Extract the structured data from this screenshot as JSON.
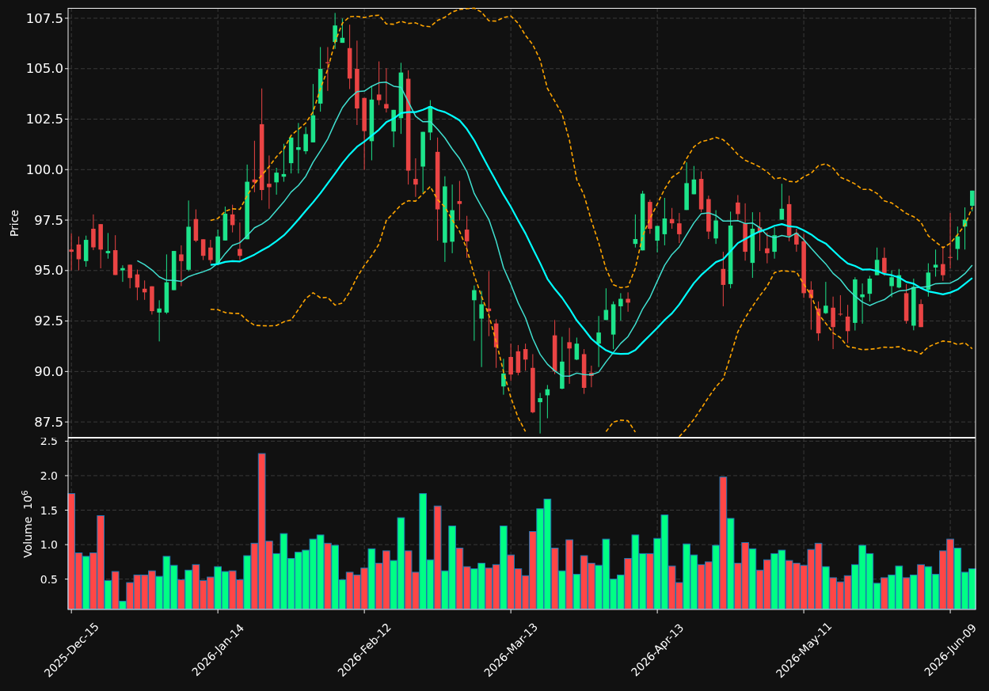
{
  "price_panel": {
    "chart_data": {
      "type": "candlestick",
      "ylabel": "Price",
      "categories": [
        null,
        null,
        null,
        null,
        null,
        null,
        null,
        null,
        null,
        null,
        null,
        null,
        null,
        null,
        null,
        null,
        null,
        null,
        null,
        null,
        null,
        null,
        null,
        null,
        null,
        null,
        null,
        null,
        null,
        null,
        null,
        null,
        null,
        null,
        null,
        null,
        null,
        null,
        null,
        null,
        null,
        null,
        null,
        null,
        null,
        null,
        null,
        null,
        null,
        null,
        null,
        null,
        null,
        null,
        null,
        null,
        null,
        null,
        null,
        null,
        null,
        null,
        null,
        null,
        null,
        null,
        null,
        null,
        null,
        null,
        null,
        null,
        null,
        null,
        null,
        null,
        null,
        null,
        null,
        null,
        null,
        null,
        null,
        null,
        null,
        null,
        null,
        null,
        null,
        null,
        null,
        null,
        null,
        null,
        null,
        null,
        null,
        null,
        null,
        null,
        null,
        null,
        null,
        null,
        null,
        null,
        null,
        null,
        null,
        null,
        null,
        null,
        null,
        null,
        null,
        null,
        null,
        null,
        null,
        null,
        null,
        null,
        null,
        null
      ],
      "ylim": [
        86.72,
        108.01
      ],
      "yticks": [
        {
          "value": 87.5,
          "label": "87.5"
        },
        {
          "value": 90,
          "label": "90.0"
        },
        {
          "value": 92.5,
          "label": "92.5"
        },
        {
          "value": 95,
          "label": "95.0"
        },
        {
          "value": 97.5,
          "label": "97.5"
        },
        {
          "value": 100,
          "label": "100.0"
        },
        {
          "value": 102.5,
          "label": "102.5"
        },
        {
          "value": 105,
          "label": "105.0"
        },
        {
          "value": 107.5,
          "label": "107.5"
        }
      ],
      "grid": true,
      "ohlc": [
        [
          96.04,
          96.84,
          95.01,
          95.93
        ],
        [
          96.29,
          96.69,
          95.01,
          95.56
        ],
        [
          95.47,
          96.73,
          95.19,
          96.52
        ],
        [
          97.07,
          97.78,
          96.01,
          96.15
        ],
        [
          97.3,
          97.3,
          95.11,
          96.04
        ],
        [
          95.86,
          96.86,
          95.59,
          95.97
        ],
        [
          96.01,
          96.75,
          94.78,
          94.78
        ],
        [
          95.01,
          95.26,
          94.44,
          95.12
        ],
        [
          95.29,
          95.29,
          94.12,
          94.63
        ],
        [
          94.81,
          95.05,
          93.53,
          94.16
        ],
        [
          94.1,
          94.51,
          93.55,
          93.92
        ],
        [
          94.22,
          94.22,
          92.82,
          92.99
        ],
        [
          92.92,
          93.53,
          91.49,
          93.12
        ],
        [
          92.92,
          95.8,
          92.85,
          94.42
        ],
        [
          94.03,
          95.97,
          94.03,
          95.97
        ],
        [
          95.8,
          96.25,
          94.23,
          95.47
        ],
        [
          95.04,
          98.47,
          94.97,
          97.17
        ],
        [
          97.55,
          98.03,
          96.41,
          96.48
        ],
        [
          96.55,
          96.55,
          95.52,
          95.73
        ],
        [
          96.14,
          96.52,
          95.36,
          95.52
        ],
        [
          95.33,
          97.03,
          95.26,
          96.69
        ],
        [
          96.49,
          98.17,
          96.49,
          97.82
        ],
        [
          97.78,
          98.26,
          96.89,
          97.25
        ],
        [
          96.07,
          97.38,
          95.52,
          95.73
        ],
        [
          96.55,
          100.25,
          96.55,
          99.4
        ],
        [
          99.51,
          101.43,
          98.88,
          99.37
        ],
        [
          102.25,
          104.02,
          98.48,
          98.99
        ],
        [
          99.3,
          100.7,
          98.06,
          99.13
        ],
        [
          99.37,
          100.09,
          98.76,
          99.85
        ],
        [
          99.65,
          101.28,
          99.4,
          99.78
        ],
        [
          100.32,
          101.59,
          99.81,
          101.59
        ],
        [
          100.98,
          102.31,
          99.81,
          101.11
        ],
        [
          100.91,
          102.11,
          100.77,
          101.76
        ],
        [
          101.35,
          104.24,
          101.35,
          102.69
        ],
        [
          103.27,
          106.07,
          102.87,
          104.99
        ],
        [
          105.32,
          106.07,
          103.9,
          105.27
        ],
        [
          106.32,
          107.76,
          105.98,
          107.14
        ],
        [
          106.28,
          107.49,
          106.28,
          106.53
        ],
        [
          106.02,
          107.18,
          103.99,
          104.51
        ],
        [
          104.99,
          106.39,
          102.21,
          103.03
        ],
        [
          103.55,
          103.55,
          99.99,
          101.91
        ],
        [
          101.41,
          104.13,
          100.46,
          103.47
        ],
        [
          103.72,
          105.36,
          103.2,
          103.44
        ],
        [
          103.25,
          105.02,
          102.83,
          103.03
        ],
        [
          101.89,
          102.96,
          101.11,
          102.96
        ],
        [
          102.55,
          105.29,
          101.77,
          104.81
        ],
        [
          104.5,
          104.92,
          99.26,
          99.95
        ],
        [
          99.54,
          100.56,
          98.65,
          99.26
        ],
        [
          100.15,
          101.87,
          98.85,
          101.87
        ],
        [
          101.84,
          103.44,
          101.46,
          103.14
        ],
        [
          100.88,
          101.59,
          96.48,
          98.03
        ],
        [
          96.38,
          99.67,
          95.43,
          99.17
        ],
        [
          96.43,
          99.26,
          95.86,
          97.99
        ],
        [
          98.44,
          99.44,
          97.48,
          98.3
        ],
        [
          97.03,
          97.71,
          95.63,
          96.45
        ],
        [
          93.53,
          94.26,
          91.52,
          94.03
        ],
        [
          92.62,
          93.99,
          90.22,
          93.33
        ],
        [
          93.12,
          94.97,
          91.75,
          92.99
        ],
        [
          92.38,
          92.59,
          90.18,
          91.2
        ],
        [
          89.26,
          90.63,
          88.85,
          89.9
        ],
        [
          90.72,
          91.38,
          89.53,
          89.85
        ],
        [
          91.0,
          91.31,
          89.81,
          89.94
        ],
        [
          91.11,
          91.38,
          90.04,
          90.59
        ],
        [
          90.18,
          90.86,
          87.93,
          87.98
        ],
        [
          88.48,
          88.94,
          86.93,
          88.68
        ],
        [
          88.82,
          89.33,
          87.68,
          89.12
        ],
        [
          91.79,
          92.55,
          89.87,
          90.01
        ],
        [
          89.15,
          91.72,
          89.12,
          90.49
        ],
        [
          91.45,
          92.16,
          89.39,
          91.14
        ],
        [
          90.59,
          91.68,
          90.56,
          91.38
        ],
        [
          90.86,
          91.11,
          88.89,
          89.19
        ],
        [
          89.94,
          90.29,
          89.22,
          89.78
        ],
        [
          91.38,
          92.75,
          90.22,
          91.93
        ],
        [
          92.55,
          94.12,
          92.55,
          93.05
        ],
        [
          91.83,
          93.47,
          91.11,
          93.33
        ],
        [
          93.23,
          93.88,
          92.52,
          93.6
        ],
        [
          93.6,
          93.92,
          92.96,
          93.41
        ],
        [
          96.32,
          97.78,
          96.14,
          96.56
        ],
        [
          96.0,
          98.95,
          96.0,
          98.81
        ],
        [
          98.4,
          98.51,
          96.82,
          97.07
        ],
        [
          96.48,
          97.21,
          95.9,
          97.21
        ],
        [
          96.8,
          98.6,
          96.25,
          97.58
        ],
        [
          97.55,
          98.1,
          97.07,
          97.34
        ],
        [
          97.34,
          97.85,
          96.36,
          96.8
        ],
        [
          98.0,
          100.36,
          98.0,
          99.33
        ],
        [
          98.78,
          100.18,
          98.78,
          99.51
        ],
        [
          99.54,
          99.91,
          97.89,
          98.03
        ],
        [
          98.54,
          98.71,
          96.56,
          96.93
        ],
        [
          96.59,
          97.99,
          96.32,
          97.48
        ],
        [
          95.08,
          95.93,
          93.23,
          94.29
        ],
        [
          94.33,
          97.92,
          94.12,
          97.23
        ],
        [
          98.37,
          98.74,
          97.44,
          97.8
        ],
        [
          97.34,
          98.33,
          95.49,
          95.93
        ],
        [
          95.38,
          97.89,
          94.64,
          97.07
        ],
        [
          97.14,
          97.89,
          95.97,
          96.89
        ],
        [
          96.1,
          96.89,
          95.36,
          95.86
        ],
        [
          95.93,
          97.14,
          95.59,
          96.75
        ],
        [
          97.52,
          99.3,
          97.52,
          98.06
        ],
        [
          98.29,
          98.71,
          96.45,
          96.73
        ],
        [
          96.86,
          97.07,
          95.93,
          96.29
        ],
        [
          96.45,
          96.82,
          93.64,
          93.88
        ],
        [
          94.05,
          94.47,
          92.07,
          93.64
        ],
        [
          93.12,
          93.47,
          91.52,
          91.89
        ],
        [
          92.89,
          94.44,
          92.85,
          93.26
        ],
        [
          93.16,
          93.71,
          91.11,
          92.2
        ],
        [
          92.86,
          93.78,
          92.75,
          92.82
        ],
        [
          92.72,
          93.3,
          91.41,
          92.0
        ],
        [
          92.41,
          94.67,
          92.03,
          94.56
        ],
        [
          93.68,
          94.36,
          92.37,
          93.82
        ],
        [
          93.85,
          94.74,
          93.47,
          94.6
        ],
        [
          94.77,
          96.14,
          94.77,
          95.53
        ],
        [
          95.63,
          96.14,
          94.74,
          94.88
        ],
        [
          94.23,
          95.01,
          93.68,
          94.67
        ],
        [
          94.16,
          95.08,
          94.12,
          94.77
        ],
        [
          93.88,
          94.33,
          92.37,
          92.51
        ],
        [
          92.27,
          94.6,
          92.04,
          94.19
        ],
        [
          93.34,
          93.57,
          92.2,
          92.2
        ],
        [
          94.05,
          95.36,
          93.71,
          94.9
        ],
        [
          95.15,
          96.04,
          94.7,
          95.29
        ],
        [
          95.32,
          96.21,
          94.49,
          94.77
        ],
        [
          95.67,
          97.85,
          95.11,
          95.63
        ],
        [
          96.07,
          97.18,
          95.52,
          96.69
        ],
        [
          97.18,
          98.13,
          96.04,
          97.52
        ],
        [
          98.21,
          98.96,
          97.93,
          98.96
        ]
      ]
    },
    "indicator_lines": {
      "chart_data": {
        "type": "line",
        "categories": [
          null,
          null,
          null,
          null,
          null,
          null,
          null,
          null,
          null,
          null,
          null,
          null,
          null,
          null,
          null,
          null,
          null,
          null,
          null,
          null,
          null,
          null,
          null,
          null,
          null,
          null,
          null,
          null,
          null,
          null,
          null,
          null,
          null,
          null,
          null,
          null,
          null,
          null,
          null,
          null,
          null,
          null,
          null,
          null,
          null,
          null,
          null,
          null,
          null,
          null,
          null,
          null,
          null,
          null,
          null,
          null,
          null,
          null,
          null,
          null,
          null,
          null,
          null,
          null,
          null,
          null,
          null,
          null,
          null,
          null,
          null,
          null,
          null,
          null,
          null,
          null,
          null,
          null,
          null,
          null,
          null,
          null,
          null,
          null,
          null,
          null,
          null,
          null,
          null,
          null,
          null,
          null,
          null,
          null,
          null,
          null,
          null,
          null,
          null,
          null,
          null,
          null,
          null,
          null,
          null,
          null,
          null,
          null,
          null,
          null,
          null,
          null,
          null,
          null,
          null,
          null,
          null,
          null,
          null,
          null,
          null,
          null,
          null,
          null
        ],
        "ylim": [
          86.72,
          108.01
        ],
        "series": [
          {
            "color": "#40e0d0",
            "values": [
              null,
              null,
              null,
              null,
              null,
              null,
              null,
              null,
              null,
              95.49,
              95.29,
              95.03,
              94.69,
              94.52,
              94.51,
              94.46,
              94.7,
              94.83,
              94.94,
              95.08,
              95.36,
              95.84,
              96.25,
              96.38,
              96.73,
              97.12,
              97.3,
              97.56,
              97.98,
              98.4,
              98.89,
              99.22,
              99.67,
              100.37,
              100.93,
              101.52,
              102.33,
              103.07,
              103.54,
              103.86,
              103.89,
              104.13,
              104.3,
              104.33,
              104.13,
              104.08,
              103.36,
              102.64,
              102.37,
              102.38,
              102.0,
              101.57,
              101.02,
              100.55,
              99.9,
              98.82,
              98.16,
              97.53,
              96.46,
              95.14,
              94.32,
              93.4,
              92.66,
              91.63,
              90.85,
              90.36,
              90.03,
              89.78,
              89.77,
              89.92,
              89.85,
              89.84,
              89.97,
              90.48,
              90.94,
              91.39,
              91.73,
              92.34,
              93.1,
              93.67,
              94.48,
              95.26,
              95.8,
              96.17,
              96.77,
              97.36,
              97.82,
              97.86,
              97.73,
              97.45,
              97.45,
              97.47,
              97.33,
              97.36,
              97.12,
              96.75,
              96.62,
              96.74,
              96.66,
              96.86,
              96.53,
              96.11,
              95.71,
              95.33,
              94.86,
              94.55,
              94.08,
              93.73,
              93.44,
              93.27,
              93.43,
              93.56,
              93.83,
              93.99,
              94.02,
              94.15,
              94.17,
              94.21,
              94.35,
              94.37,
              94.38,
              94.56,
              94.85,
              95.27
            ]
          },
          {
            "color": "#00ffff",
            "values": [
              null,
              null,
              null,
              null,
              null,
              null,
              null,
              null,
              null,
              null,
              null,
              null,
              null,
              null,
              null,
              null,
              null,
              null,
              null,
              95.28,
              95.32,
              95.43,
              95.47,
              95.45,
              95.62,
              95.79,
              96.0,
              96.2,
              96.46,
              96.74,
              97.12,
              97.53,
              97.96,
              98.38,
              98.83,
              99.32,
              99.81,
              100.32,
              100.76,
              101.13,
              101.39,
              101.68,
              101.98,
              102.35,
              102.53,
              102.8,
              102.85,
              102.85,
              102.96,
              103.12,
              102.95,
              102.85,
              102.66,
              102.44,
              102.01,
              101.45,
              100.76,
              100.08,
              99.42,
              98.76,
              98.16,
              97.48,
              96.84,
              96.09,
              95.37,
              94.59,
              94.09,
              93.65,
              93.12,
              92.53,
              92.09,
              91.62,
              91.31,
              91.05,
              90.9,
              90.87,
              90.88,
              91.06,
              91.44,
              91.8,
              92.16,
              92.55,
              92.88,
              93.32,
              93.86,
              94.38,
              94.78,
              95.1,
              95.42,
              95.56,
              95.96,
              96.36,
              96.56,
              96.77,
              96.94,
              97.06,
              97.22,
              97.3,
              97.19,
              97.16,
              96.99,
              96.79,
              96.52,
              96.34,
              95.99,
              95.65,
              95.35,
              95.23,
              95.05,
              95.06,
              94.98,
              94.83,
              94.77,
              94.66,
              94.44,
              94.35,
              94.13,
              93.97,
              93.9,
              93.82,
              93.91,
              94.06,
              94.34,
              94.63
            ]
          },
          {
            "color": "#ffa500",
            "line_style": "dashed",
            "values": [
              null,
              null,
              null,
              null,
              null,
              null,
              null,
              null,
              null,
              null,
              null,
              null,
              null,
              null,
              null,
              null,
              null,
              null,
              null,
              97.48,
              97.58,
              97.94,
              98.06,
              98.03,
              98.71,
              99.29,
              99.73,
              100.15,
              100.64,
              101.02,
              101.69,
              102.0,
              102.31,
              102.86,
              104.01,
              104.97,
              106.33,
              107.25,
              107.58,
              107.59,
              107.53,
              107.62,
              107.65,
              107.22,
              107.2,
              107.35,
              107.24,
              107.27,
              107.12,
              107.08,
              107.39,
              107.55,
              107.81,
              107.93,
              107.97,
              108.0,
              107.8,
              107.37,
              107.36,
              107.53,
              107.61,
              107.25,
              106.65,
              106.19,
              105.44,
              104.02,
              103.39,
              102.75,
              101.46,
              99.51,
              98.73,
              97.47,
              96.37,
              95.08,
              94.3,
              94.15,
              94.2,
              95.12,
              96.72,
              97.57,
              98.3,
              99.04,
              99.62,
              99.87,
              100.55,
              101.13,
              101.39,
              101.47,
              101.6,
              101.48,
              101.15,
              100.75,
              100.46,
              100.31,
              100.13,
              99.89,
              99.54,
              99.61,
              99.42,
              99.39,
              99.65,
              99.82,
              100.2,
              100.29,
              100.07,
              99.62,
              99.47,
              99.29,
              99.02,
              99.02,
              98.82,
              98.45,
              98.35,
              98.09,
              97.83,
              97.67,
              97.39,
              96.72,
              96.42,
              96.13,
              96.35,
              96.78,
              97.26,
              98.13
            ]
          },
          {
            "color": "#ffa500",
            "line_style": "dashed",
            "values": [
              null,
              null,
              null,
              null,
              null,
              null,
              null,
              null,
              null,
              null,
              null,
              null,
              null,
              null,
              null,
              null,
              null,
              null,
              null,
              93.08,
              93.06,
              92.92,
              92.88,
              92.87,
              92.53,
              92.29,
              92.27,
              92.26,
              92.28,
              92.46,
              92.55,
              93.07,
              93.61,
              93.9,
              93.65,
              93.67,
              93.29,
              93.39,
              93.94,
              94.67,
              95.25,
              95.74,
              96.31,
              97.48,
              97.86,
              98.25,
              98.46,
              98.44,
              98.8,
              99.16,
              98.51,
              98.15,
              97.51,
              96.95,
              96.06,
              94.76,
              93.73,
              92.79,
              91.48,
              89.99,
              88.71,
              87.71,
              87.03,
              null,
              null,
              null,
              null,
              null,
              null,
              null,
              null,
              null,
              null,
              87.02,
              87.5,
              87.59,
              87.56,
              87.0,
              null,
              null,
              null,
              null,
              null,
              86.77,
              87.17,
              87.63,
              88.17,
              88.73,
              89.24,
              89.64,
              90.78,
              91.97,
              92.66,
              93.23,
              93.75,
              94.23,
              94.9,
              94.99,
              94.96,
              94.93,
              94.33,
              93.77,
              92.84,
              92.39,
              91.91,
              91.68,
              91.23,
              91.17,
              91.08,
              91.1,
              91.14,
              91.21,
              91.19,
              91.23,
              91.05,
              91.03,
              90.87,
              91.22,
              91.38,
              91.51,
              91.47,
              91.34,
              91.42,
              91.13
            ]
          }
        ]
      }
    }
  },
  "volume_panel": {
    "chart_data": {
      "type": "bar",
      "ylabel": "Volume  10$^{6}$",
      "categories": [
        "2025-Dec-15",
        null,
        null,
        null,
        null,
        null,
        null,
        null,
        null,
        null,
        null,
        null,
        null,
        null,
        null,
        null,
        null,
        null,
        null,
        null,
        "2026-Jan-14",
        null,
        null,
        null,
        null,
        null,
        null,
        null,
        null,
        null,
        null,
        null,
        null,
        null,
        null,
        null,
        null,
        null,
        null,
        null,
        "2026-Feb-12",
        null,
        null,
        null,
        null,
        null,
        null,
        null,
        null,
        null,
        null,
        null,
        null,
        null,
        null,
        null,
        null,
        null,
        null,
        null,
        "2026-Mar-13",
        null,
        null,
        null,
        null,
        null,
        null,
        null,
        null,
        null,
        null,
        null,
        null,
        null,
        null,
        null,
        null,
        null,
        null,
        null,
        "2026-Apr-13",
        null,
        null,
        null,
        null,
        null,
        null,
        null,
        null,
        null,
        null,
        null,
        null,
        null,
        null,
        null,
        null,
        null,
        null,
        null,
        "2026-May-11",
        null,
        null,
        null,
        null,
        null,
        null,
        null,
        null,
        null,
        null,
        null,
        null,
        null,
        null,
        null,
        null,
        null,
        null,
        null,
        "2026-Jun-09",
        null,
        null,
        null
      ],
      "ylim": [
        0.06,
        2.55
      ],
      "yticks": [
        {
          "value": 0.5,
          "label": "0.5"
        },
        {
          "value": 1,
          "label": "1.0"
        },
        {
          "value": 1.5,
          "label": "1.5"
        },
        {
          "value": 2,
          "label": "2.0"
        },
        {
          "value": 2.5,
          "label": "2.5"
        }
      ],
      "grid": true,
      "values": [
        1.74,
        0.88,
        0.83,
        0.88,
        1.42,
        0.48,
        0.61,
        0.18,
        0.45,
        0.56,
        0.56,
        0.62,
        0.54,
        0.83,
        0.7,
        0.49,
        0.63,
        0.71,
        0.48,
        0.53,
        0.68,
        0.61,
        0.62,
        0.49,
        0.84,
        1.02,
        2.32,
        1.05,
        0.87,
        1.16,
        0.8,
        0.89,
        0.92,
        1.08,
        1.14,
        1.02,
        0.99,
        0.49,
        0.6,
        0.56,
        0.66,
        0.94,
        0.73,
        0.91,
        0.77,
        1.39,
        0.91,
        0.6,
        1.74,
        0.78,
        1.56,
        0.62,
        1.27,
        0.95,
        0.68,
        0.65,
        0.73,
        0.66,
        0.71,
        1.27,
        0.85,
        0.65,
        0.55,
        1.19,
        1.52,
        1.66,
        0.95,
        0.62,
        1.07,
        0.57,
        0.84,
        0.73,
        0.7,
        1.08,
        0.5,
        0.56,
        0.8,
        1.14,
        0.87,
        0.87,
        1.09,
        1.43,
        0.69,
        0.45,
        1.01,
        0.85,
        0.71,
        0.75,
        0.99,
        1.98,
        1.38,
        0.73,
        1.03,
        0.94,
        0.63,
        0.78,
        0.87,
        0.92,
        0.77,
        0.73,
        0.7,
        0.93,
        1.02,
        0.68,
        0.52,
        0.46,
        0.55,
        0.71,
        0.99,
        0.87,
        0.44,
        0.52,
        0.56,
        0.69,
        0.52,
        0.56,
        0.71,
        0.68,
        0.57,
        0.91,
        1.08,
        0.95,
        0.6,
        0.65
      ]
    }
  }
}
